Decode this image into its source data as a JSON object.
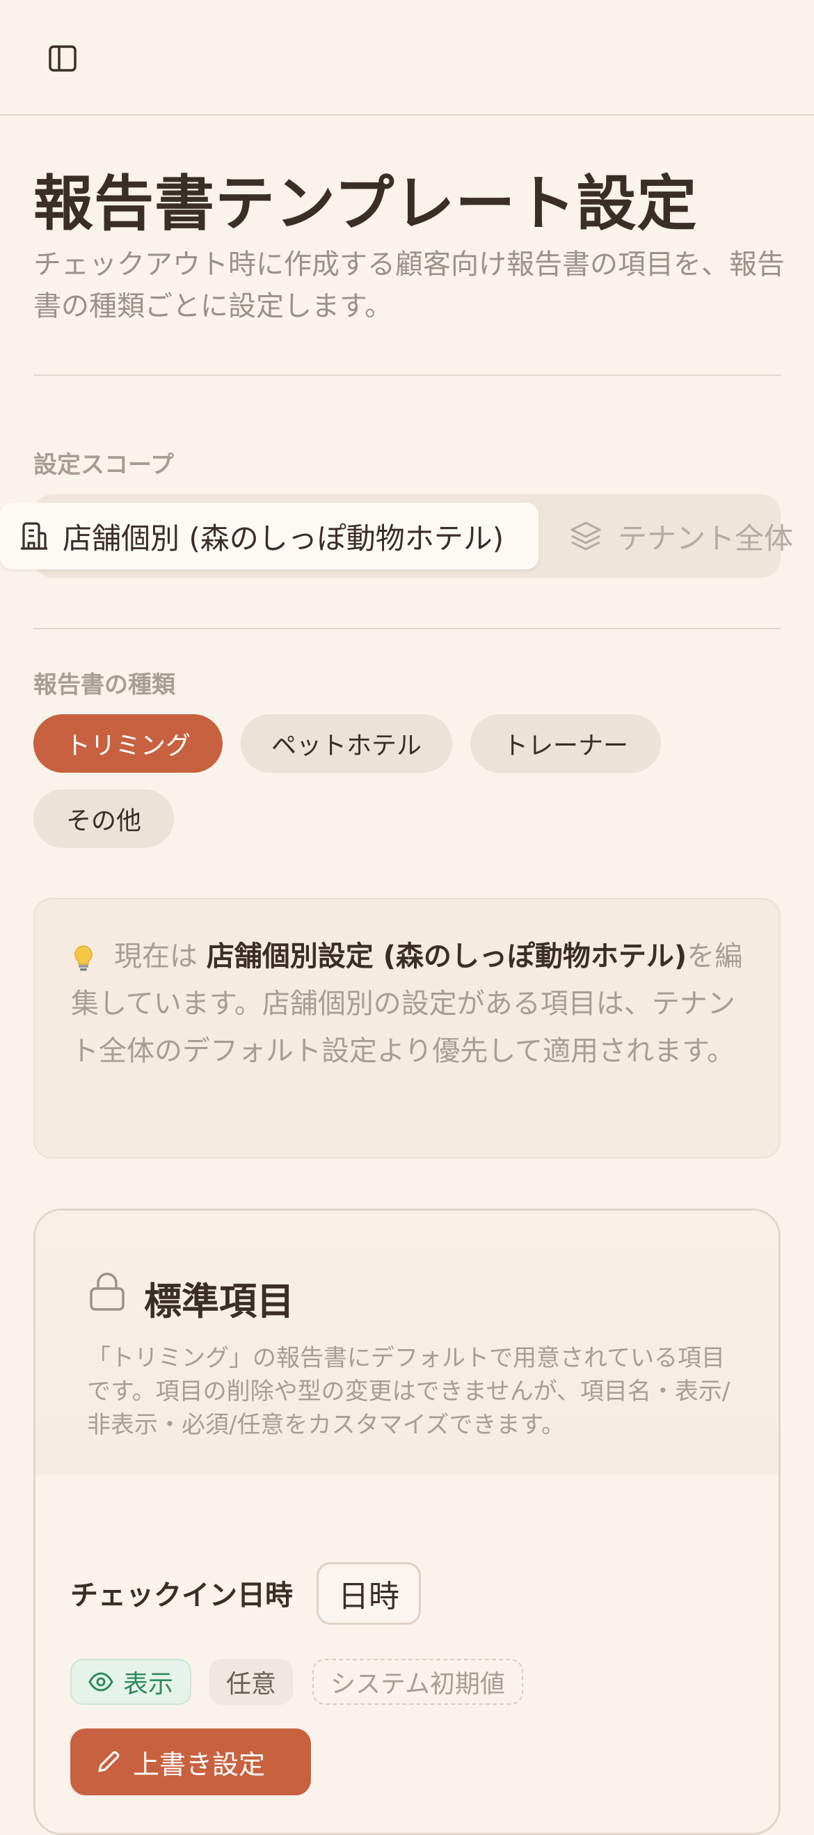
{
  "page": {
    "title": "報告書テンプレート設定",
    "subtitle": "チェックアウト時に作成する顧客向け報告書の項目を、報告書の種類ごとに設定します。"
  },
  "scope": {
    "label": "設定スコープ",
    "options": [
      {
        "label": "店舗個別 (森のしっぽ動物ホテル)",
        "icon": "building-icon",
        "selected": true
      },
      {
        "label": "テナント全体",
        "icon": "layers-icon",
        "selected": false
      }
    ]
  },
  "report_types": {
    "label": "報告書の種類",
    "items": [
      {
        "label": "トリミング",
        "selected": true
      },
      {
        "label": "ペットホテル",
        "selected": false
      },
      {
        "label": "トレーナー",
        "selected": false
      },
      {
        "label": "その他",
        "selected": false
      }
    ]
  },
  "info": {
    "icon": "lightbulb-icon",
    "prefix": "現在は",
    "emphasis": "店舗個別設定 (森のしっぽ動物ホテル)",
    "suffix": "を編集しています。店舗個別の設定がある項目は、テナント全体のデフォルト設定より優先して適用されます。"
  },
  "standard_section": {
    "icon": "lock-icon",
    "title": "標準項目",
    "description": "「トリミング」の報告書にデフォルトで用意されている項目です。項目の削除や型の変更はできませんが、項目名・表示/非表示・必須/任意をカスタマイズできます。",
    "fields": [
      {
        "name": "チェックイン日時",
        "type": "日時",
        "visibility": "表示",
        "requirement": "任意",
        "source": "システム初期値",
        "override_label": "上書き設定"
      }
    ]
  },
  "colors": {
    "accent": "#c8613f",
    "background": "#faf3eb",
    "visible_badge": "#2f8a5a"
  }
}
